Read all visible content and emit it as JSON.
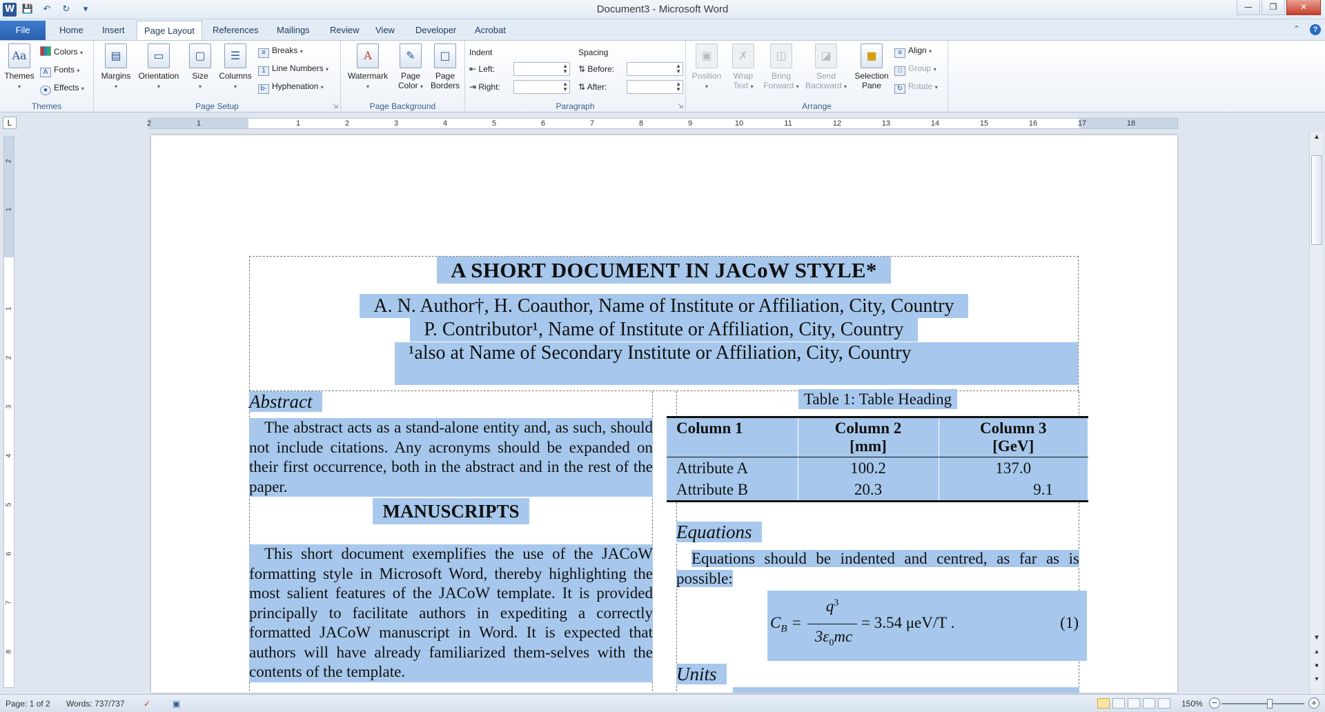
{
  "window": {
    "title": "Document3 - Microsoft Word",
    "app_icon": "W",
    "qat": [
      "save-icon",
      "undo-icon",
      "redo-icon",
      "customize-icon"
    ]
  },
  "tabs": {
    "file": "File",
    "items": [
      "Home",
      "Insert",
      "Page Layout",
      "References",
      "Mailings",
      "Review",
      "View",
      "Developer",
      "Acrobat"
    ],
    "active": "Page Layout"
  },
  "ribbon": {
    "themes": {
      "group": "Themes",
      "themes": "Themes",
      "colors": "Colors",
      "fonts": "Fonts",
      "effects": "Effects"
    },
    "page_setup": {
      "group": "Page Setup",
      "margins": "Margins",
      "orientation": "Orientation",
      "size": "Size",
      "columns": "Columns",
      "breaks": "Breaks",
      "line_numbers": "Line Numbers",
      "hyphenation": "Hyphenation"
    },
    "page_background": {
      "group": "Page Background",
      "watermark": "Watermark",
      "page_color_1": "Page",
      "page_color_2": "Color",
      "page_borders_1": "Page",
      "page_borders_2": "Borders"
    },
    "paragraph": {
      "group": "Paragraph",
      "indent": "Indent",
      "left": "Left:",
      "right": "Right:",
      "spacing": "Spacing",
      "before": "Before:",
      "after": "After:"
    },
    "arrange": {
      "group": "Arrange",
      "position": "Position",
      "wrap_1": "Wrap",
      "wrap_2": "Text",
      "bring_1": "Bring",
      "bring_2": "Forward",
      "send_1": "Send",
      "send_2": "Backward",
      "selection_1": "Selection",
      "selection_2": "Pane",
      "align": "Align",
      "group_btn": "Group",
      "rotate": "Rotate"
    }
  },
  "ruler": {
    "tab_selector": "L",
    "h_numbers": [
      "2",
      "1",
      "1",
      "2",
      "3",
      "4",
      "5",
      "6",
      "7",
      "8",
      "9",
      "10",
      "11",
      "12",
      "13",
      "14",
      "15",
      "16",
      "17",
      "18"
    ],
    "v_numbers": [
      "2",
      "1",
      "1",
      "2",
      "3",
      "4",
      "5",
      "6",
      "7",
      "8"
    ]
  },
  "document": {
    "title": "A SHORT DOCUMENT IN JACoW STYLE*",
    "authors_1": "A. N. Author†, H. Coauthor, Name of Institute or Affiliation,  City,  Country",
    "authors_2": "P. Contributor¹, Name of Institute  or Affiliation,  City,  Country",
    "authors_3": "¹also  at Name of Secondary Institute  or Affiliation,  City,  Country",
    "abstract_heading": "Abstract",
    "abstract_text": "The abstract acts as a stand-alone entity and, as such, should not include citations. Any acronyms should be expanded on their first occurrence, both in the abstract and in the rest of the paper.",
    "manuscripts_heading": "MANUSCRIPTS",
    "manuscripts_text": "This short document exemplifies the use of the JACoW formatting style in Microsoft Word, thereby highlighting the most salient features of the JACoW template. It is provided principally to facilitate authors in expediting a correctly formatted JACoW manuscript in Word. It is expected that authors will have already familiarized them-selves with the contents of the template.",
    "table_caption": "Table 1: Table Heading",
    "table": {
      "headers": [
        "Column 1",
        "Column 2",
        "[mm]",
        "Column 3",
        "[GeV]"
      ],
      "rows": [
        [
          "Attribute A",
          "100.2",
          "137.0"
        ],
        [
          "Attribute B",
          "20.3",
          "9.1"
        ]
      ]
    },
    "equations_heading": "Equations",
    "equations_text": "Equations should be indented and centred, as far as is possible:",
    "equation": {
      "lhs": "C",
      "lhs_sub": "B",
      "numerator": "q",
      "numerator_sup": "3",
      "denominator": "3ε",
      "denominator_sub": "0",
      "denominator_rest": "mc",
      "rhs": "= 3.54 μeV/T .",
      "number": "(1)"
    },
    "units_heading": "Units"
  },
  "status": {
    "page": "Page: 1 of 2",
    "words": "Words: 737/737",
    "zoom": "150%"
  }
}
